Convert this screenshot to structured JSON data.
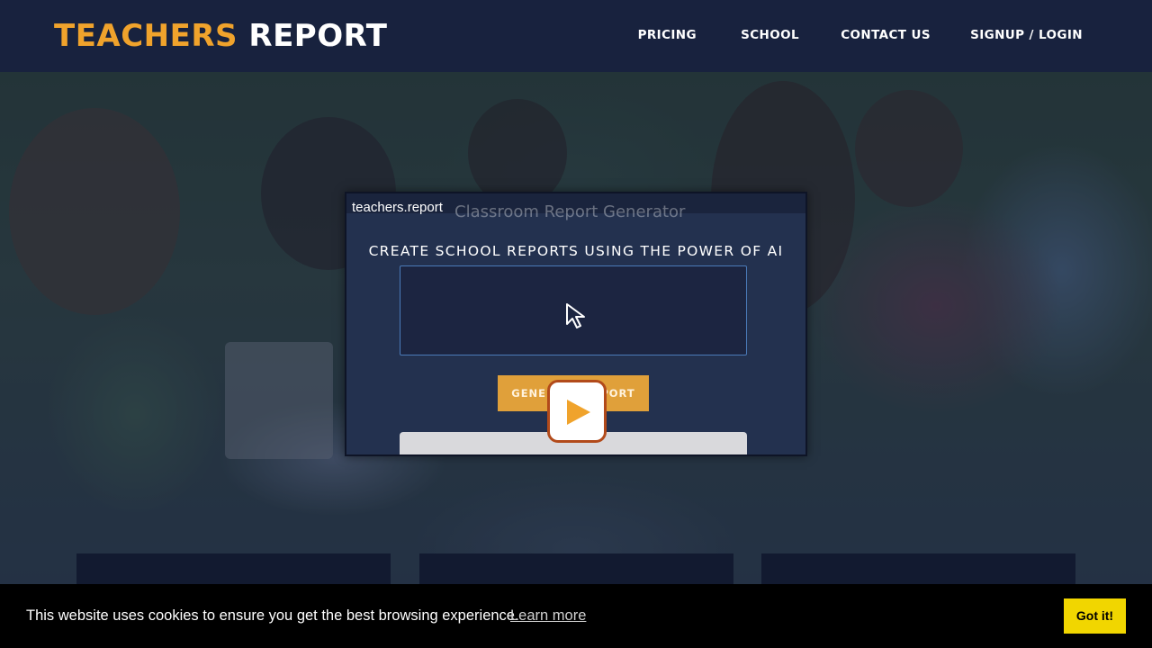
{
  "header": {
    "logo_part1": "TEACHERS",
    "logo_part2": "REPORT",
    "nav": [
      {
        "label": "PRICING"
      },
      {
        "label": "SCHOOL"
      },
      {
        "label": "CONTACT US"
      },
      {
        "label": "SIGNUP / LOGIN"
      }
    ]
  },
  "video": {
    "site_label": "teachers.report",
    "faded_heading": "Classroom Report Generator",
    "tagline": "CREATE SCHOOL REPORTS USING THE POWER OF AI",
    "button_label": "GENERATE REPORT"
  },
  "cookie": {
    "message": "This website uses cookies to ensure you get the best browsing experience.",
    "learn_more": "Learn more",
    "accept": "Got it!"
  },
  "colors": {
    "brand_orange": "#f0a32c",
    "header_bg": "#18223e",
    "cookie_button": "#f1d600",
    "play_border": "#b24a1a"
  }
}
